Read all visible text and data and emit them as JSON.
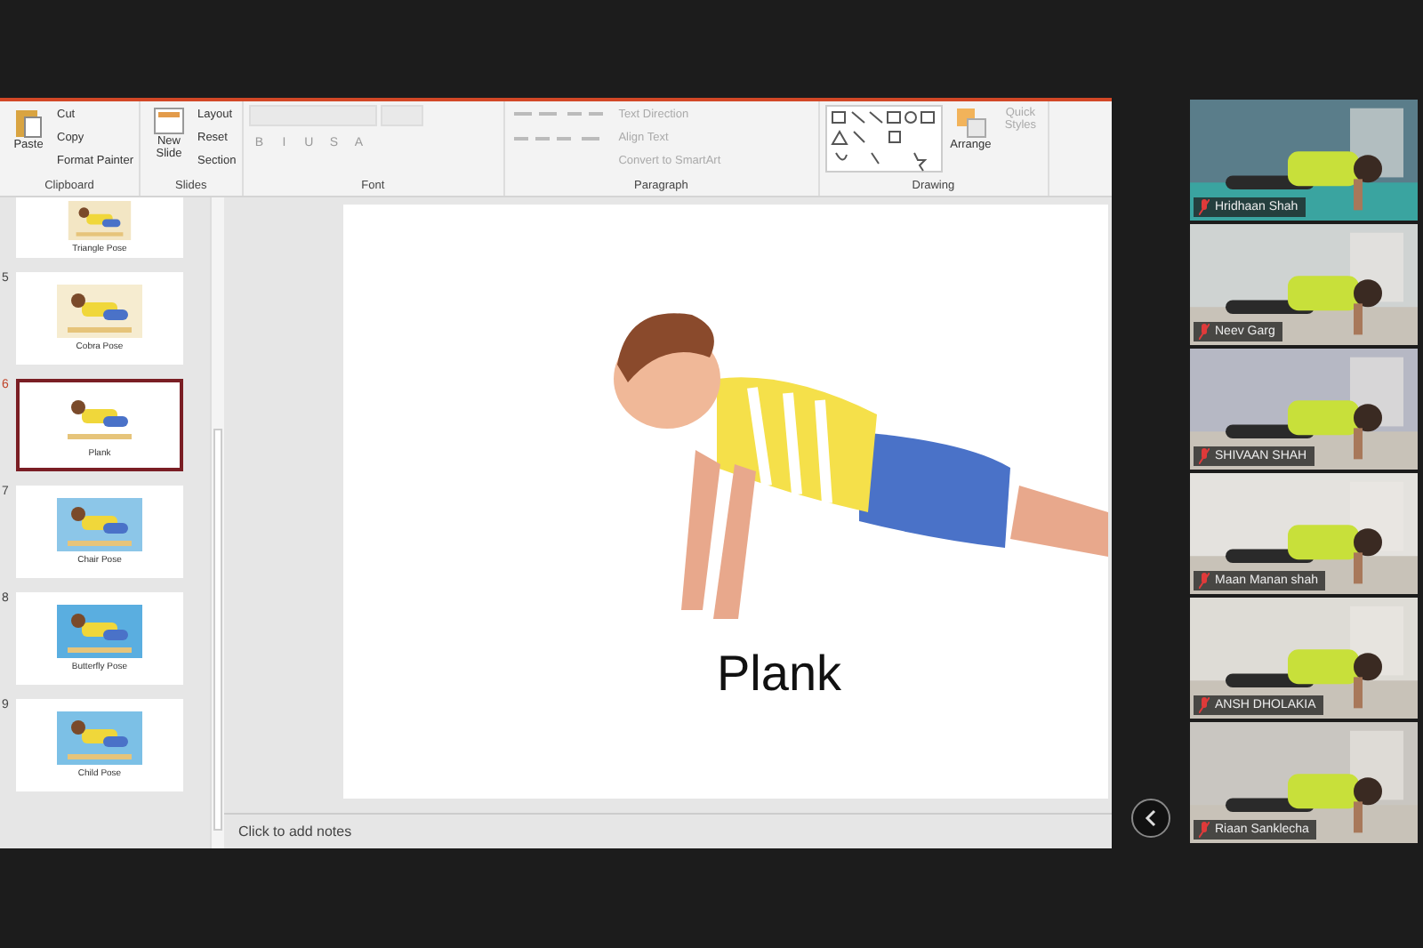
{
  "ribbon": {
    "clipboard": {
      "paste": "Paste",
      "items": [
        "Cut",
        "Copy",
        "Format Painter"
      ],
      "label": "Clipboard"
    },
    "slides": {
      "new_slide": "New Slide",
      "items": [
        "Layout",
        "Reset",
        "Section"
      ],
      "label": "Slides"
    },
    "font": {
      "label": "Font",
      "buttons": [
        "B",
        "I",
        "U",
        "S",
        "A"
      ]
    },
    "paragraph": {
      "items": [
        {
          "label": "Text Direction",
          "disabled": true
        },
        {
          "label": "Align Text",
          "disabled": true
        },
        {
          "label": "Convert to SmartArt",
          "disabled": true
        }
      ],
      "label": "Paragraph"
    },
    "drawing": {
      "arrange": "Arrange",
      "quick_styles": {
        "label": "Quick Styles",
        "disabled": true
      },
      "label": "Drawing"
    }
  },
  "thumbnails": [
    {
      "caption": "Triangle Pose",
      "selected": false
    },
    {
      "number": "5",
      "caption": "Cobra Pose",
      "selected": false
    },
    {
      "number": "6",
      "caption": "Plank",
      "selected": true
    },
    {
      "number": "7",
      "caption": "Chair Pose",
      "selected": false
    },
    {
      "number": "8",
      "caption": "Butterfly Pose",
      "selected": false
    },
    {
      "number": "9",
      "caption": "Child Pose",
      "selected": false
    }
  ],
  "slide": {
    "title": "Plank"
  },
  "notes": {
    "placeholder": "Click to add notes"
  },
  "participants": [
    {
      "name": "Hridhaan Shah"
    },
    {
      "name": "Neev Garg"
    },
    {
      "name": "SHIVAAN SHAH"
    },
    {
      "name": "Maan Manan shah"
    },
    {
      "name": "ANSH DHOLAKIA"
    },
    {
      "name": "Riaan Sanklecha"
    }
  ]
}
